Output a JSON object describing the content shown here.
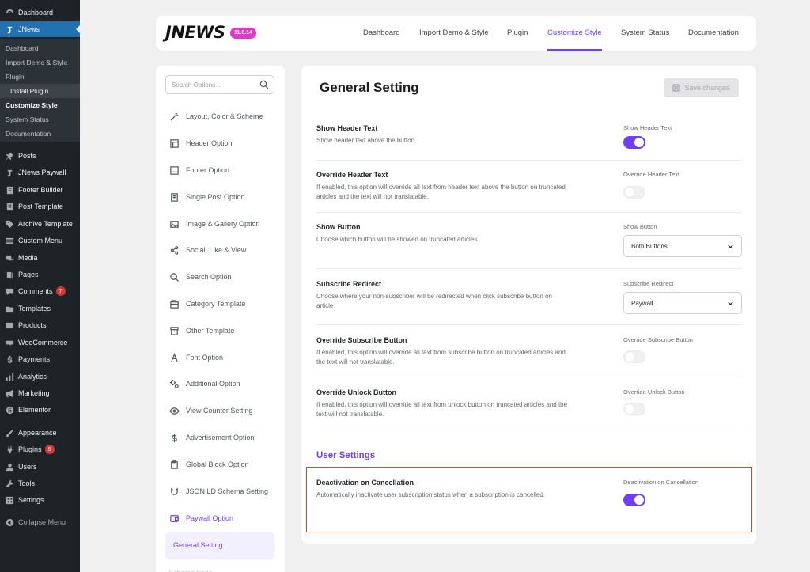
{
  "wp_menu": {
    "dashboard": "Dashboard",
    "jnews": "JNews",
    "submenu": {
      "dashboard": "Dashboard",
      "import_demo": "Import Demo & Style",
      "plugin": "Plugin",
      "install_plugin": "Install Plugin",
      "customize_style": "Customize Style",
      "system_status": "System Status",
      "documentation": "Documentation"
    },
    "posts": "Posts",
    "jnews_paywall": "JNews Paywall",
    "footer_builder": "Footer Builder",
    "post_template": "Post Template",
    "archive_template": "Archive Template",
    "custom_menu": "Custom Menu",
    "media": "Media",
    "pages": "Pages",
    "comments": "Comments",
    "comments_count": "7",
    "templates": "Templates",
    "products": "Products",
    "woocommerce": "WooCommerce",
    "payments": "Payments",
    "analytics": "Analytics",
    "marketing": "Marketing",
    "elementor": "Elementor",
    "appearance": "Appearance",
    "plugins": "Plugins",
    "plugins_count": "5",
    "users": "Users",
    "tools": "Tools",
    "settings": "Settings",
    "collapse": "Collapse Menu"
  },
  "header": {
    "logo": "JNEWS",
    "version": "11.6.14",
    "nav": {
      "dashboard": "Dashboard",
      "import_demo": "Import Demo & Style",
      "plugin": "Plugin",
      "customize_style": "Customize Style",
      "system_status": "System Status",
      "documentation": "Documentation"
    }
  },
  "options": {
    "search_placeholder": "Search Options...",
    "items": {
      "layout": "Layout, Color & Scheme",
      "header": "Header Option",
      "footer": "Footer Option",
      "single_post": "Single Post Option",
      "image_gallery": "Image & Gallery Option",
      "social": "Social, Like & View",
      "search": "Search Option",
      "category": "Category Template",
      "other": "Other Template",
      "font": "Font Option",
      "additional": "Additional Option",
      "view_counter": "View Counter Setting",
      "advertisement": "Advertisement Option",
      "global_block": "Global Block Option",
      "json_ld": "JSON LD Schema Setting",
      "paywall": "Paywall Option",
      "general_setting": "General Setting",
      "scheme_style": "Scheme Style"
    }
  },
  "main": {
    "title": "General Setting",
    "save_label": "Save changes",
    "settings": {
      "show_header_text": {
        "title": "Show Header Text",
        "desc": "Show header text above the button.",
        "label": "Show Header Text",
        "enabled": true
      },
      "override_header_text": {
        "title": "Override Header Text",
        "desc": "If enabled, this option will override all text from header text above the button on truncated articles and the text will not translatable.",
        "label": "Override Header Text",
        "enabled": false
      },
      "show_button": {
        "title": "Show Button",
        "desc": "Choose which button will be showed on truncated articles",
        "label": "Show Button",
        "value": "Both Buttons"
      },
      "subscribe_redirect": {
        "title": "Subscribe Redirect",
        "desc": "Choose where your non-subscriber will be redirected when click subscribe button on article",
        "label": "Subscribe Redirect",
        "value": "Paywall"
      },
      "override_subscribe": {
        "title": "Override Subscribe Button",
        "desc": "If enabled, this option will override all text from subscribe button on truncated articles and the text will not translatable.",
        "label": "Override Subscribe Button",
        "enabled": false
      },
      "override_unlock": {
        "title": "Override Unlock Button",
        "desc": "If enabled, this option will override all text from unlock button on truncated articles and the text will not translatable.",
        "label": "Override Unlock Button",
        "enabled": false
      }
    },
    "user_settings_title": "User Settings",
    "deactivation": {
      "title": "Deactivation on Cancellation",
      "desc": "Automatically inactivate user subscription status when a subscription is cancelled.",
      "label": "Deactivation on Cancellation",
      "enabled": true
    }
  },
  "colors": {
    "accent": "#6e3ff3",
    "wp_sidebar": "#1d2327",
    "wp_active": "#2271b1",
    "highlight": "#d7482a",
    "version_badge": "#e337c9"
  }
}
